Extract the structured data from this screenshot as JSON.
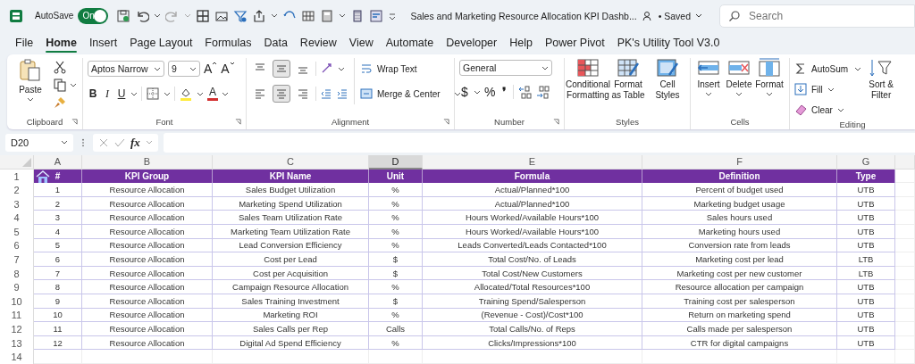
{
  "title_bar": {
    "autosave": {
      "label": "AutoSave",
      "state_text": "On",
      "on": true
    },
    "document_title": "Sales and Marketing Resource Allocation KPI Dashb...",
    "save_status": "• Saved",
    "search": {
      "placeholder": "Search"
    }
  },
  "menu_tabs": [
    {
      "label": "File",
      "selected": false
    },
    {
      "label": "Home",
      "selected": true
    },
    {
      "label": "Insert",
      "selected": false
    },
    {
      "label": "Page Layout",
      "selected": false
    },
    {
      "label": "Formulas",
      "selected": false
    },
    {
      "label": "Data",
      "selected": false
    },
    {
      "label": "Review",
      "selected": false
    },
    {
      "label": "View",
      "selected": false
    },
    {
      "label": "Automate",
      "selected": false
    },
    {
      "label": "Developer",
      "selected": false
    },
    {
      "label": "Help",
      "selected": false
    },
    {
      "label": "Power Pivot",
      "selected": false
    },
    {
      "label": "PK's Utility Tool V3.0",
      "selected": false
    }
  ],
  "ribbon": {
    "clipboard": {
      "label": "Clipboard",
      "paste": "Paste"
    },
    "font": {
      "label": "Font",
      "font_name": "Aptos Narrow",
      "font_size": "9",
      "grow": "A",
      "shrink": "A",
      "bold": "B",
      "italic": "I",
      "underline": "U",
      "font_color": "A"
    },
    "alignment": {
      "label": "Alignment",
      "wrap_text": "Wrap Text",
      "merge_center": "Merge & Center",
      "vertical_align": [
        {
          "selected": false
        },
        {
          "selected": true
        },
        {
          "selected": false
        }
      ],
      "horizontal_align": [
        {
          "selected": false
        },
        {
          "selected": true
        },
        {
          "selected": false
        }
      ]
    },
    "number": {
      "label": "Number",
      "format": "General",
      "currency": "$",
      "percent": "%",
      "comma": "❜"
    },
    "styles": {
      "label": "Styles",
      "conditional": "Conditional Formatting",
      "format_table": "Format as Table",
      "cell_styles": "Cell Styles"
    },
    "cells": {
      "label": "Cells",
      "insert": "Insert",
      "delete": "Delete",
      "format": "Format"
    },
    "editing": {
      "label": "Editing",
      "autosum": "AutoSum",
      "fill": "Fill",
      "clear": "Clear",
      "sort": "Sort & Filter"
    }
  },
  "formula_bar": {
    "name_box": "D20",
    "function_label": "fx"
  },
  "sheet": {
    "columns": [
      {
        "letter": "A",
        "selected": false
      },
      {
        "letter": "B",
        "selected": false
      },
      {
        "letter": "C",
        "selected": false
      },
      {
        "letter": "D",
        "selected": true
      },
      {
        "letter": "E",
        "selected": false
      },
      {
        "letter": "F",
        "selected": false
      },
      {
        "letter": "G",
        "selected": false
      }
    ],
    "row_numbers": [
      "1",
      "2",
      "3",
      "4",
      "5",
      "6",
      "7",
      "8",
      "9",
      "10",
      "11",
      "12",
      "13",
      "14"
    ],
    "header": [
      "#",
      "KPI Group",
      "KPI Name",
      "Unit",
      "Formula",
      "Definition",
      "Type"
    ],
    "rows": [
      [
        "1",
        "Resource Allocation",
        "Sales Budget Utilization",
        "%",
        "Actual/Planned*100",
        "Percent of budget used",
        "UTB"
      ],
      [
        "2",
        "Resource Allocation",
        "Marketing Spend Utilization",
        "%",
        "Actual/Planned*100",
        "Marketing budget usage",
        "UTB"
      ],
      [
        "3",
        "Resource Allocation",
        "Sales Team Utilization Rate",
        "%",
        "Hours Worked/Available Hours*100",
        "Sales hours used",
        "UTB"
      ],
      [
        "4",
        "Resource Allocation",
        "Marketing Team Utilization Rate",
        "%",
        "Hours Worked/Available Hours*100",
        "Marketing hours used",
        "UTB"
      ],
      [
        "5",
        "Resource Allocation",
        "Lead Conversion Efficiency",
        "%",
        "Leads Converted/Leads Contacted*100",
        "Conversion rate from leads",
        "UTB"
      ],
      [
        "6",
        "Resource Allocation",
        "Cost per Lead",
        "$",
        "Total Cost/No. of Leads",
        "Marketing cost per lead",
        "LTB"
      ],
      [
        "7",
        "Resource Allocation",
        "Cost per Acquisition",
        "$",
        "Total Cost/New Customers",
        "Marketing cost per new customer",
        "LTB"
      ],
      [
        "8",
        "Resource Allocation",
        "Campaign Resource Allocation",
        "%",
        "Allocated/Total Resources*100",
        "Resource allocation per campaign",
        "UTB"
      ],
      [
        "9",
        "Resource Allocation",
        "Sales Training Investment",
        "$",
        "Training Spend/Salesperson",
        "Training cost per salesperson",
        "UTB"
      ],
      [
        "10",
        "Resource Allocation",
        "Marketing ROI",
        "%",
        "(Revenue - Cost)/Cost*100",
        "Return on marketing spend",
        "UTB"
      ],
      [
        "11",
        "Resource Allocation",
        "Sales Calls per Rep",
        "Calls",
        "Total Calls/No. of Reps",
        "Calls made per salesperson",
        "UTB"
      ],
      [
        "12",
        "Resource Allocation",
        "Digital Ad Spend Efficiency",
        "%",
        "Clicks/Impressions*100",
        "CTR for digital campaigns",
        "UTB"
      ]
    ]
  }
}
